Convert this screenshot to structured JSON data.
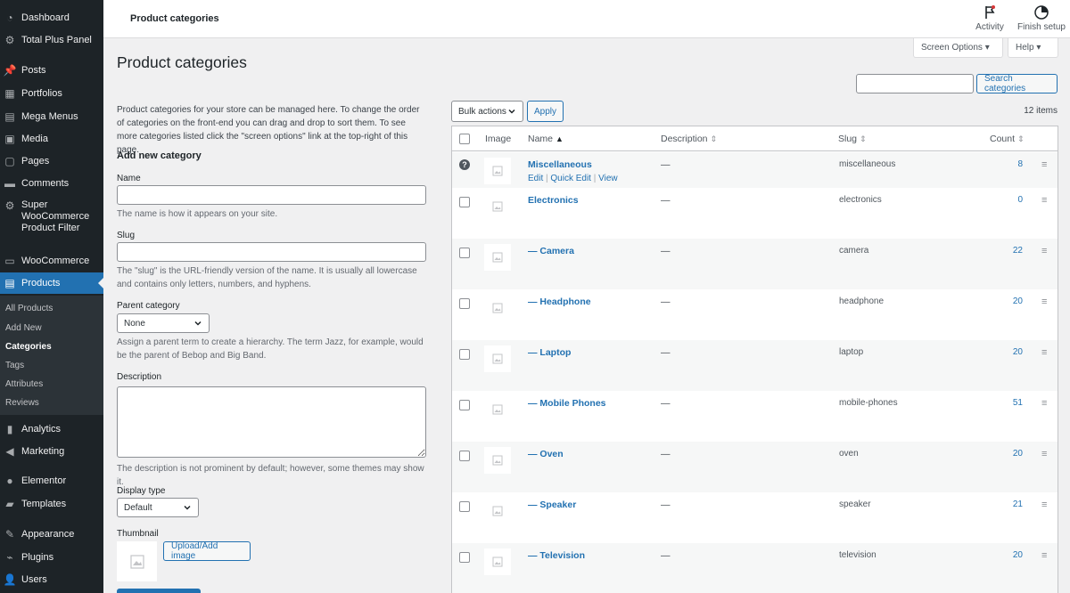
{
  "sidebar": {
    "items": [
      {
        "label": "Dashboard",
        "icon": "dashboard-icon"
      },
      {
        "label": "Total Plus Panel",
        "icon": "gear-icon"
      },
      {
        "label": "Posts",
        "icon": "pin-icon"
      },
      {
        "label": "Portfolios",
        "icon": "grid-icon"
      },
      {
        "label": "Mega Menus",
        "icon": "menu-icon"
      },
      {
        "label": "Media",
        "icon": "media-icon"
      },
      {
        "label": "Pages",
        "icon": "pages-icon"
      },
      {
        "label": "Comments",
        "icon": "comment-icon"
      },
      {
        "label": "Super WooCommerce Product Filter",
        "icon": "filter-icon"
      },
      {
        "label": "WooCommerce",
        "icon": "woo-icon"
      },
      {
        "label": "Products",
        "icon": "archive-icon"
      },
      {
        "label": "Analytics",
        "icon": "chart-icon"
      },
      {
        "label": "Marketing",
        "icon": "megaphone-icon"
      },
      {
        "label": "Elementor",
        "icon": "elementor-icon"
      },
      {
        "label": "Templates",
        "icon": "folder-icon"
      },
      {
        "label": "Appearance",
        "icon": "brush-icon"
      },
      {
        "label": "Plugins",
        "icon": "plug-icon"
      },
      {
        "label": "Users",
        "icon": "user-icon"
      }
    ],
    "submenu": [
      "All Products",
      "Add New",
      "Categories",
      "Tags",
      "Attributes",
      "Reviews"
    ]
  },
  "header": {
    "title": "Product categories",
    "activity_label": "Activity",
    "finish_label": "Finish setup",
    "screen_options": "Screen Options ▾",
    "help": "Help ▾"
  },
  "page": {
    "title": "Product categories",
    "intro": "Product categories for your store can be managed here. To change the order of categories on the front-end you can drag and drop to sort them. To see more categories listed click the \"screen options\" link at the top-right of this page."
  },
  "form": {
    "heading": "Add new category",
    "name_label": "Name",
    "name_help": "The name is how it appears on your site.",
    "slug_label": "Slug",
    "slug_help": "The \"slug\" is the URL-friendly version of the name. It is usually all lowercase and contains only letters, numbers, and hyphens.",
    "parent_label": "Parent category",
    "parent_value": "None",
    "parent_help": "Assign a parent term to create a hierarchy. The term Jazz, for example, would be the parent of Bebop and Big Band.",
    "desc_label": "Description",
    "desc_help": "The description is not prominent by default; however, some themes may show it.",
    "display_label": "Display type",
    "display_value": "Default",
    "thumb_label": "Thumbnail",
    "upload_label": "Upload/Add image"
  },
  "list": {
    "search_button": "Search categories",
    "bulk_actions": "Bulk actions",
    "apply": "Apply",
    "items_count": "12 items",
    "columns": {
      "image": "Image",
      "name": "Name",
      "description": "Description",
      "slug": "Slug",
      "count": "Count"
    },
    "row_actions": {
      "edit": "Edit",
      "quick_edit": "Quick Edit",
      "view": "View"
    },
    "rows": [
      {
        "name": "Miscellaneous",
        "desc": "—",
        "slug": "miscellaneous",
        "count": "8"
      },
      {
        "name": "Electronics",
        "desc": "—",
        "slug": "electronics",
        "count": "0"
      },
      {
        "name": "— Camera",
        "desc": "—",
        "slug": "camera",
        "count": "22"
      },
      {
        "name": "— Headphone",
        "desc": "—",
        "slug": "headphone",
        "count": "20"
      },
      {
        "name": "— Laptop",
        "desc": "—",
        "slug": "laptop",
        "count": "20"
      },
      {
        "name": "— Mobile Phones",
        "desc": "—",
        "slug": "mobile-phones",
        "count": "51"
      },
      {
        "name": "— Oven",
        "desc": "—",
        "slug": "oven",
        "count": "20"
      },
      {
        "name": "— Speaker",
        "desc": "—",
        "slug": "speaker",
        "count": "21"
      },
      {
        "name": "— Television",
        "desc": "—",
        "slug": "television",
        "count": "20"
      }
    ]
  },
  "colors": {
    "sidebar": "#1d2327",
    "accent": "#2271b1",
    "background": "#f0f0f1"
  }
}
